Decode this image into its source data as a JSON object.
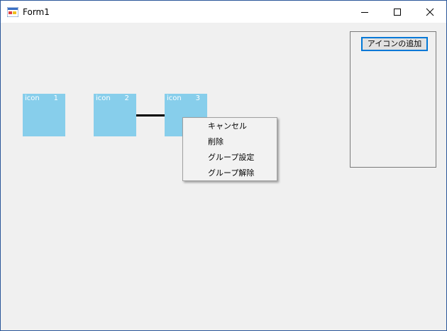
{
  "window": {
    "title": "Form1",
    "minimize_icon": "minimize-icon",
    "maximize_icon": "maximize-icon",
    "close_icon": "close-icon"
  },
  "icons": [
    {
      "name": "icon",
      "number": "1"
    },
    {
      "name": "icon",
      "number": "2"
    },
    {
      "name": "icon",
      "number": "3"
    }
  ],
  "panel": {
    "add_button_label": "アイコンの追加"
  },
  "context_menu": {
    "items": [
      "キャンセル",
      "削除",
      "グループ設定",
      "グループ解除"
    ]
  },
  "colors": {
    "icon_fill": "#87ceeb",
    "icon_text": "#ffffff",
    "background": "#f0f0f0",
    "accent": "#0078d7"
  }
}
